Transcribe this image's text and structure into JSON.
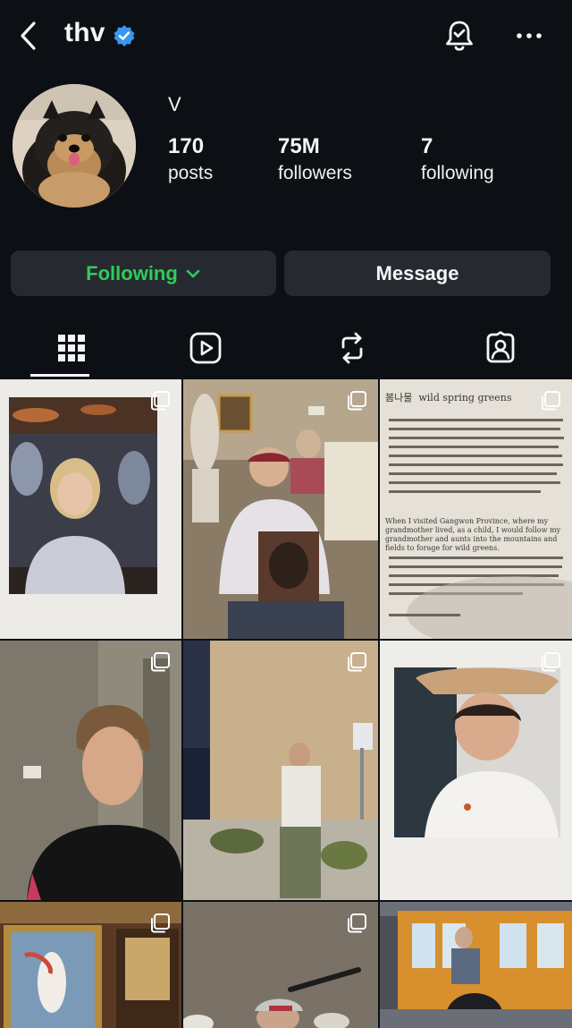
{
  "header": {
    "username": "thv",
    "verified": true,
    "icons": {
      "back": "chevron-left-icon",
      "notifications": "bell-check-icon",
      "more": "more-horizontal-icon"
    }
  },
  "profile": {
    "display_name": "V",
    "stats": {
      "posts": {
        "value": "170",
        "label": "posts"
      },
      "followers": {
        "value": "75M",
        "label": "followers"
      },
      "following": {
        "value": "7",
        "label": "following"
      }
    }
  },
  "actions": {
    "following_label": "Following",
    "message_label": "Message"
  },
  "tabs": [
    {
      "name": "grid",
      "icon": "grid-icon",
      "active": true
    },
    {
      "name": "reels",
      "icon": "reels-icon",
      "active": false
    },
    {
      "name": "reposts",
      "icon": "repost-icon",
      "active": false
    },
    {
      "name": "tagged",
      "icon": "tagged-icon",
      "active": false
    }
  ],
  "posts": [
    {
      "description": "polaroid photo",
      "multi": true
    },
    {
      "description": "museum photo",
      "multi": true
    },
    {
      "description": "book page",
      "multi": true
    },
    {
      "description": "portrait",
      "multi": true
    },
    {
      "description": "outdoor wall",
      "multi": true
    },
    {
      "description": "cowboy hat polaroid",
      "multi": true
    },
    {
      "description": "painting",
      "multi": true
    },
    {
      "description": "indoor",
      "multi": true
    },
    {
      "description": "street kiosk",
      "multi": false
    }
  ],
  "book_page": {
    "heading_ko": "봄나물",
    "heading_en": "wild spring greens",
    "body_en": "When I visited Gangwon Province, where my grandmother lived, as a child, I would follow my grandmother and aunts into the mountains and fields to forage for wild greens."
  },
  "colors": {
    "background": "#0c1014",
    "button_bg": "#262a30",
    "following_green": "#2ecc59",
    "verified_blue": "#3897f0"
  }
}
